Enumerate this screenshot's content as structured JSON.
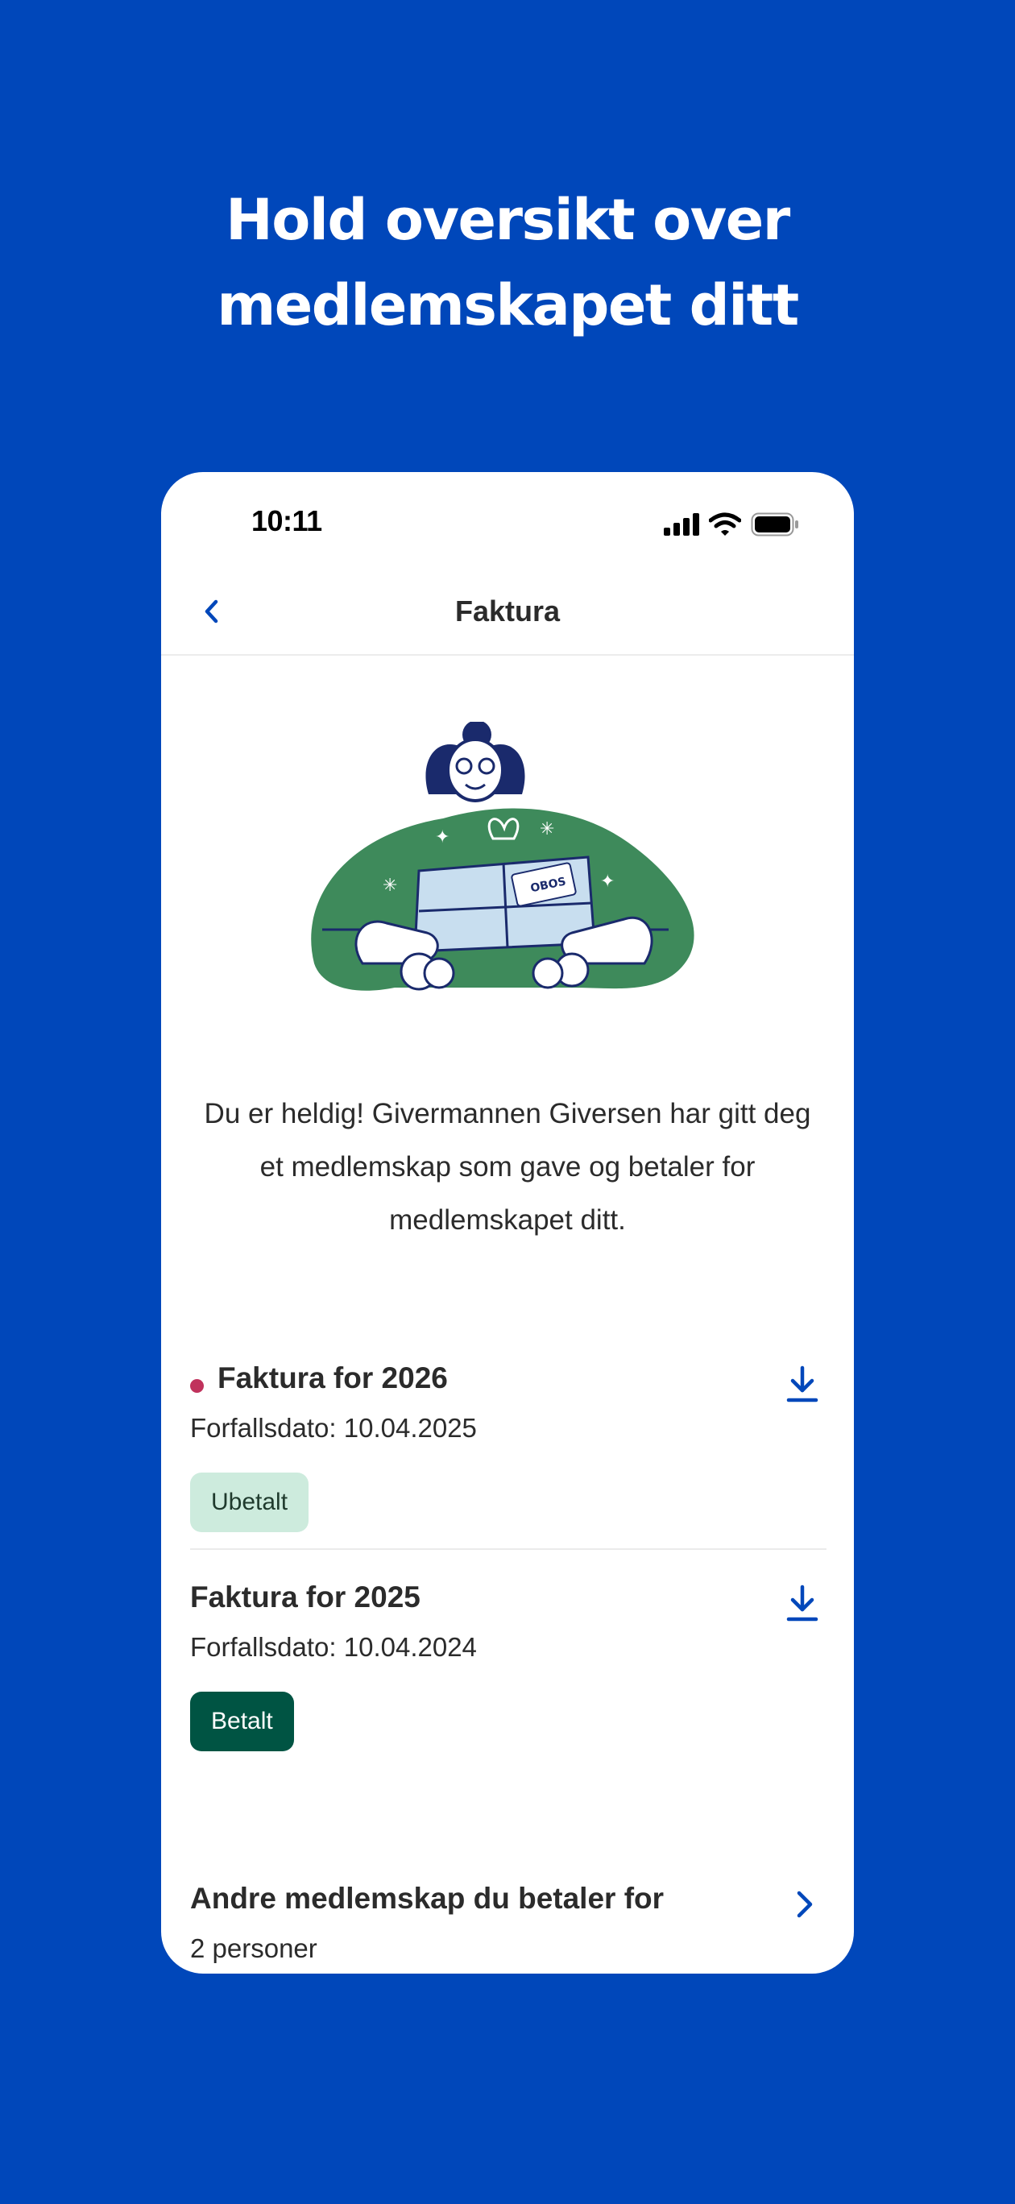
{
  "headline": {
    "line1": "Hold oversikt over",
    "line2": "medlemskapet ditt"
  },
  "status_bar": {
    "time": "10:11"
  },
  "navbar": {
    "title": "Faktura"
  },
  "gift_message": "Du er heldig! Givermannen Giversen har gitt deg et medlemskap som gave og betaler for medlemskapet ditt.",
  "illustration": {
    "brand_label": "OBOS"
  },
  "invoices": [
    {
      "title": "Faktura for 2026",
      "due_date": "Forfallsdato: 10.04.2025",
      "status": "Ubetalt",
      "unread": true
    },
    {
      "title": "Faktura for 2025",
      "due_date": "Forfallsdato: 10.04.2024",
      "status": "Betalt",
      "unread": false
    }
  ],
  "other_memberships": {
    "title": "Andre medlemskap du betaler for",
    "subtitle": "2 personer"
  },
  "colors": {
    "background": "#0047BA",
    "accent": "#0047BA",
    "unpaid_badge": "#CDEBDD",
    "paid_badge": "#005443",
    "unread_dot": "#C0325C",
    "illustration_green": "#3E8A5B"
  }
}
